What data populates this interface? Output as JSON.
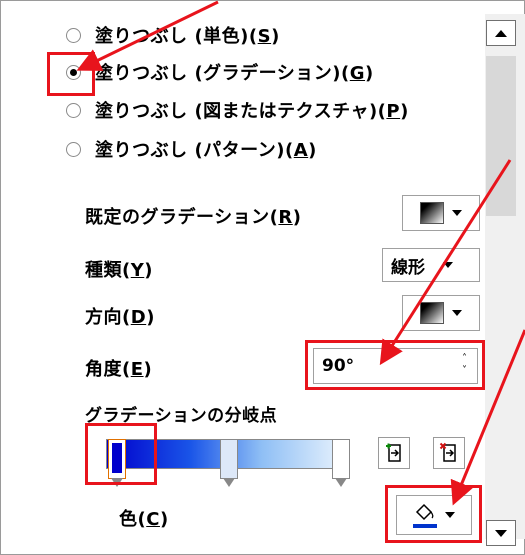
{
  "fill_options": [
    {
      "text": "塗りつぶし (単色)(",
      "key": "S",
      "end": ")",
      "checked": false
    },
    {
      "text": "塗りつぶし (グラデーション)(",
      "key": "G",
      "end": ")",
      "checked": true
    },
    {
      "text": "塗りつぶし (図またはテクスチャ)(",
      "key": "P",
      "end": ")",
      "checked": false
    },
    {
      "text": "塗りつぶし (パターン)(",
      "key": "A",
      "end": ")",
      "checked": false
    }
  ],
  "preset": {
    "text": "既定のグラデーション(",
    "key": "R",
    "end": ")"
  },
  "type": {
    "text": "種類(",
    "key": "Y",
    "end": ")",
    "value": "線形"
  },
  "direction": {
    "text": "方向(",
    "key": "D",
    "end": ")"
  },
  "angle": {
    "text": "角度(",
    "key": "E",
    "end": ")",
    "value": "90°"
  },
  "stops_label": "グラデーションの分岐点",
  "color": {
    "text": "色(",
    "key": "C",
    "end": ")"
  },
  "colors": {
    "highlight": "#e8141c",
    "accent": "#0033cc",
    "stop_selected": "#0000cc"
  }
}
